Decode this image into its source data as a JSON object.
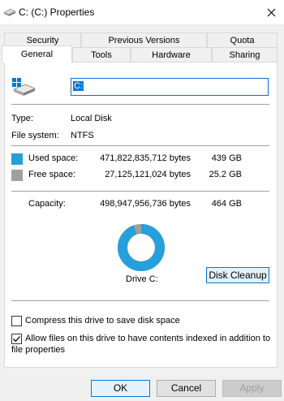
{
  "window": {
    "title": "C: (C:) Properties"
  },
  "tabs_top": [
    "Security",
    "Previous Versions",
    "Quota"
  ],
  "tabs_bottom": [
    "General",
    "Tools",
    "Hardware",
    "Sharing"
  ],
  "general": {
    "drive_name": "C:",
    "type_label": "Type:",
    "type_value": "Local Disk",
    "fs_label": "File system:",
    "fs_value": "NTFS",
    "used_label": "Used space:",
    "used_bytes": "471,822,835,712 bytes",
    "used_gb": "439 GB",
    "free_label": "Free space:",
    "free_bytes": "27,125,121,024 bytes",
    "free_gb": "25.2 GB",
    "capacity_label": "Capacity:",
    "capacity_bytes": "498,947,956,736 bytes",
    "capacity_gb": "464 GB",
    "drive_label": "Drive C:",
    "cleanup_button": "Disk Cleanup",
    "compress_label": "Compress this drive to save disk space",
    "compress_checked": false,
    "index_label_line1": "Allow files on this drive to have contents indexed in addition to",
    "index_label_line2": "file properties",
    "index_checked": true
  },
  "usage": {
    "used_fraction": 0.9456,
    "used_color": "#26a0da",
    "free_color": "#a0a0a0"
  },
  "buttons": {
    "ok": "OK",
    "cancel": "Cancel",
    "apply": "Apply"
  }
}
